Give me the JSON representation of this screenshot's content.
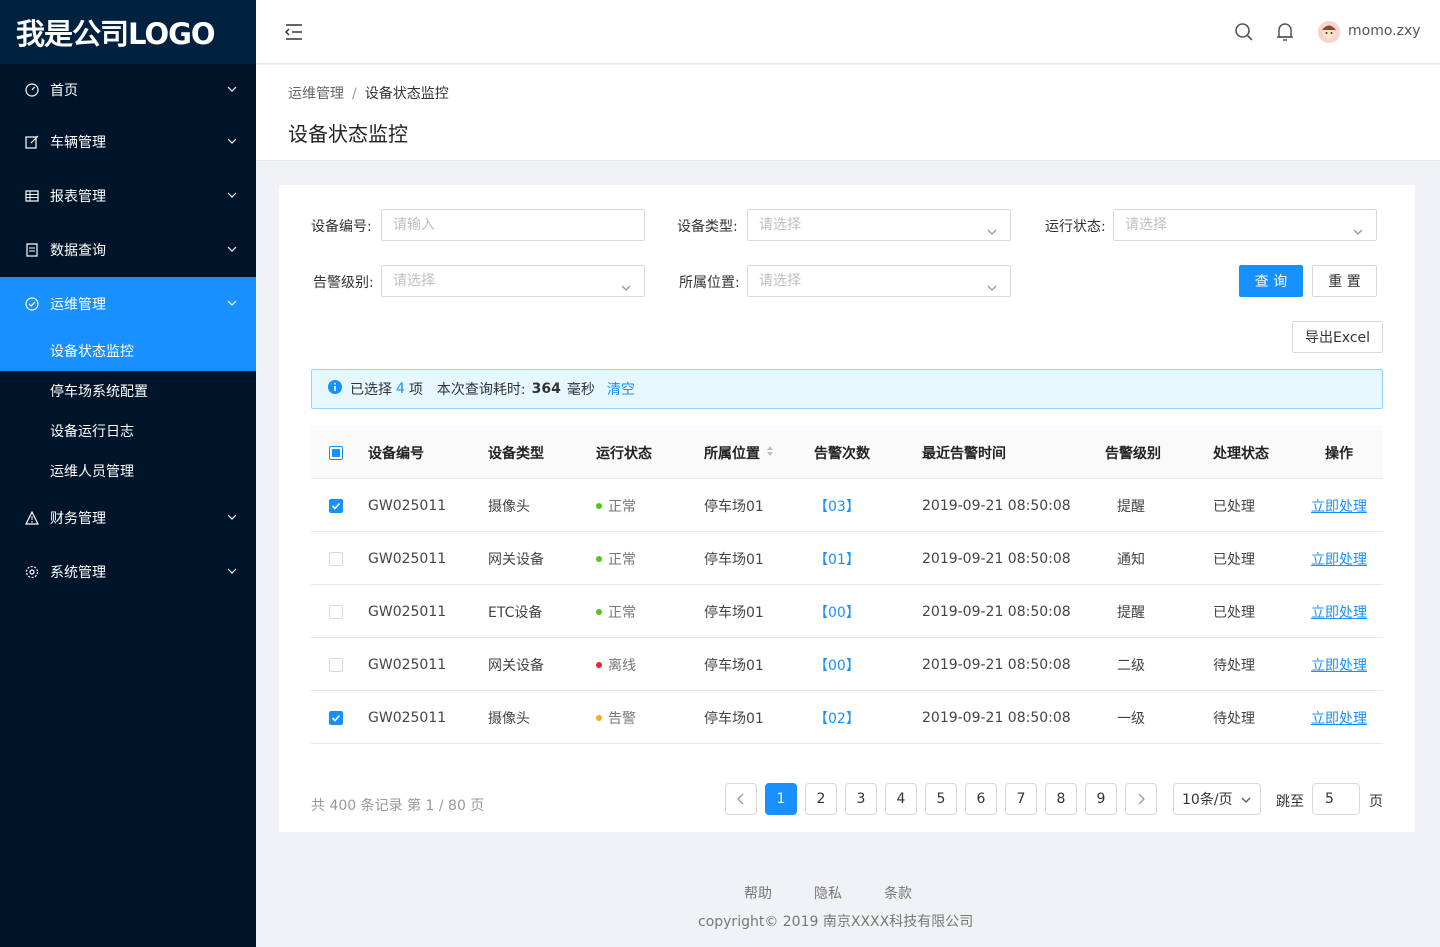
{
  "logo": "我是公司LOGO",
  "sidebar": {
    "items": [
      {
        "label": "首页",
        "icon": "dashboard-icon"
      },
      {
        "label": "车辆管理",
        "icon": "edit-icon"
      },
      {
        "label": "报表管理",
        "icon": "table-icon"
      },
      {
        "label": "数据查询",
        "icon": "document-icon"
      },
      {
        "label": "运维管理",
        "icon": "check-circle-icon"
      },
      {
        "label": "财务管理",
        "icon": "warning-icon"
      },
      {
        "label": "系统管理",
        "icon": "setting-icon"
      }
    ],
    "subitems": [
      {
        "label": "设备状态监控"
      },
      {
        "label": "停车场系统配置"
      },
      {
        "label": "设备运行日志"
      },
      {
        "label": "运维人员管理"
      }
    ]
  },
  "header": {
    "username": "momo.zxy"
  },
  "breadcrumb": {
    "parent": "运维管理",
    "sep": "/",
    "current": "设备状态监控"
  },
  "page_title": "设备状态监控",
  "filters": {
    "device_no_label": "设备编号:",
    "device_no_placeholder": "请输入",
    "device_type_label": "设备类型:",
    "device_type_placeholder": "请选择",
    "run_status_label": "运行状态:",
    "run_status_placeholder": "请选择",
    "alarm_level_label": "告警级别:",
    "alarm_level_placeholder": "请选择",
    "location_label": "所属位置:",
    "location_placeholder": "请选择",
    "query_button": "查 询",
    "reset_button": "重 置",
    "export_button": "导出Excel"
  },
  "alert": {
    "selected_prefix": "已选择",
    "selected_count": "4",
    "selected_suffix": "项",
    "time_label": "本次查询耗时:",
    "time_value": "364",
    "time_unit": "毫秒",
    "clear": "清空"
  },
  "table": {
    "headers": [
      "设备编号",
      "设备类型",
      "运行状态",
      "所属位置",
      "告警次数",
      "最近告警时间",
      "告警级别",
      "处理状态",
      "操作"
    ],
    "rows": [
      {
        "checked": true,
        "id": "GW025011",
        "type": "摄像头",
        "status": "正常",
        "status_color": "#52c41a",
        "location": "停车场01",
        "count": "【03】",
        "time": "2019-09-21  08:50:08",
        "level": "提醒",
        "handle": "已处理",
        "action": "立即处理"
      },
      {
        "checked": false,
        "id": "GW025011",
        "type": "网关设备",
        "status": "正常",
        "status_color": "#52c41a",
        "location": "停车场01",
        "count": "【01】",
        "time": "2019-09-21  08:50:08",
        "level": "通知",
        "handle": "已处理",
        "action": "立即处理"
      },
      {
        "checked": false,
        "id": "GW025011",
        "type": "ETC设备",
        "status": "正常",
        "status_color": "#52c41a",
        "location": "停车场01",
        "count": "【00】",
        "time": "2019-09-21  08:50:08",
        "level": "提醒",
        "handle": "已处理",
        "action": "立即处理"
      },
      {
        "checked": false,
        "id": "GW025011",
        "type": "网关设备",
        "status": "离线",
        "status_color": "#f5222d",
        "location": "停车场01",
        "count": "【00】",
        "time": "2019-09-21  08:50:08",
        "level": "二级",
        "handle": "待处理",
        "action": "立即处理"
      },
      {
        "checked": true,
        "id": "GW025011",
        "type": "摄像头",
        "status": "告警",
        "status_color": "#faad14",
        "location": "停车场01",
        "count": "【02】",
        "time": "2019-09-21  08:50:08",
        "level": "一级",
        "handle": "待处理",
        "action": "立即处理"
      }
    ]
  },
  "pagination": {
    "total_text": "共 400 条记录  第 1 / 80 页",
    "pages": [
      "1",
      "2",
      "3",
      "4",
      "5",
      "6",
      "7",
      "8",
      "9"
    ],
    "current": "1",
    "page_size": "10条/页",
    "jump_label": "跳至",
    "jump_value": "5",
    "jump_suffix": "页"
  },
  "footer": {
    "links": [
      "帮助",
      "隐私",
      "条款"
    ],
    "copyright": "copyright© 2019 南京XXXX科技有限公司"
  },
  "colors": {
    "primary": "#1890ff",
    "sidebar_bg": "#001529",
    "success": "#52c41a",
    "error": "#f5222d",
    "warning": "#faad14"
  }
}
